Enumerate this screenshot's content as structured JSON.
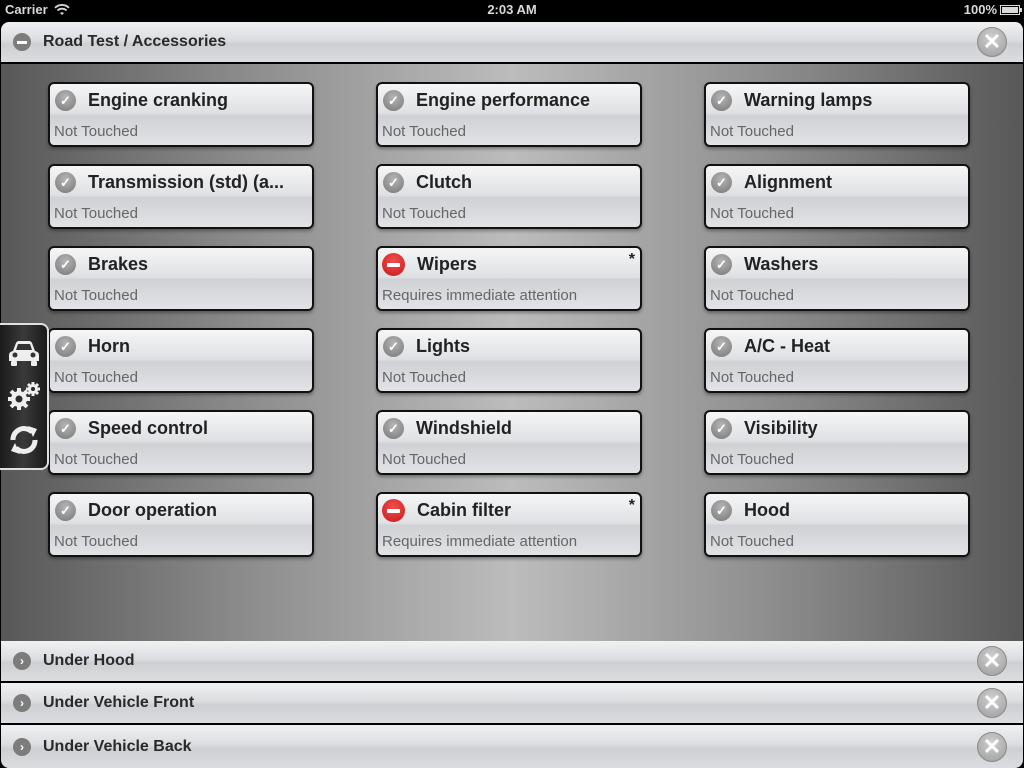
{
  "status_bar": {
    "carrier": "Carrier",
    "time": "2:03 AM",
    "battery": "100%"
  },
  "sections": {
    "road_test": {
      "title": "Road Test / Accessories",
      "expanded": true
    },
    "under_hood": {
      "title": "Under Hood",
      "expanded": false
    },
    "under_vehicle_front": {
      "title": "Under Vehicle Front",
      "expanded": false
    },
    "under_vehicle_back": {
      "title": "Under Vehicle Back",
      "expanded": false
    }
  },
  "items": [
    {
      "name": "Engine cranking",
      "status": "Not Touched",
      "state": "ok",
      "flag": ""
    },
    {
      "name": "Engine performance",
      "status": "Not Touched",
      "state": "ok",
      "flag": ""
    },
    {
      "name": "Warning lamps",
      "status": "Not Touched",
      "state": "ok",
      "flag": ""
    },
    {
      "name": "Transmission (std) (a...",
      "status": "Not Touched",
      "state": "ok",
      "flag": ""
    },
    {
      "name": "Clutch",
      "status": "Not Touched",
      "state": "ok",
      "flag": ""
    },
    {
      "name": "Alignment",
      "status": "Not Touched",
      "state": "ok",
      "flag": ""
    },
    {
      "name": "Brakes",
      "status": "Not Touched",
      "state": "ok",
      "flag": ""
    },
    {
      "name": "Wipers",
      "status": "Requires immediate attention",
      "state": "alert",
      "flag": "*"
    },
    {
      "name": "Washers",
      "status": "Not Touched",
      "state": "ok",
      "flag": ""
    },
    {
      "name": "Horn",
      "status": "Not Touched",
      "state": "ok",
      "flag": ""
    },
    {
      "name": "Lights",
      "status": "Not Touched",
      "state": "ok",
      "flag": ""
    },
    {
      "name": "A/C - Heat",
      "status": "Not Touched",
      "state": "ok",
      "flag": ""
    },
    {
      "name": "Speed control",
      "status": "Not Touched",
      "state": "ok",
      "flag": ""
    },
    {
      "name": "Windshield",
      "status": "Not Touched",
      "state": "ok",
      "flag": ""
    },
    {
      "name": "Visibility",
      "status": "Not Touched",
      "state": "ok",
      "flag": ""
    },
    {
      "name": "Door operation",
      "status": "Not Touched",
      "state": "ok",
      "flag": ""
    },
    {
      "name": "Cabin filter",
      "status": "Requires immediate attention",
      "state": "alert",
      "flag": "*"
    },
    {
      "name": "Hood",
      "status": "Not Touched",
      "state": "ok",
      "flag": ""
    }
  ],
  "icons": {
    "collapse": "minus-circle-icon",
    "expand": "chevron-right-circle-icon",
    "close": "close-circle-icon",
    "ok": "checkmark-circle-icon",
    "alert": "do-not-enter-icon",
    "tools": [
      "car-icon",
      "gears-icon",
      "refresh-icon"
    ]
  },
  "colors": {
    "alert": "#d42424",
    "ok": "#8a8a8a"
  }
}
